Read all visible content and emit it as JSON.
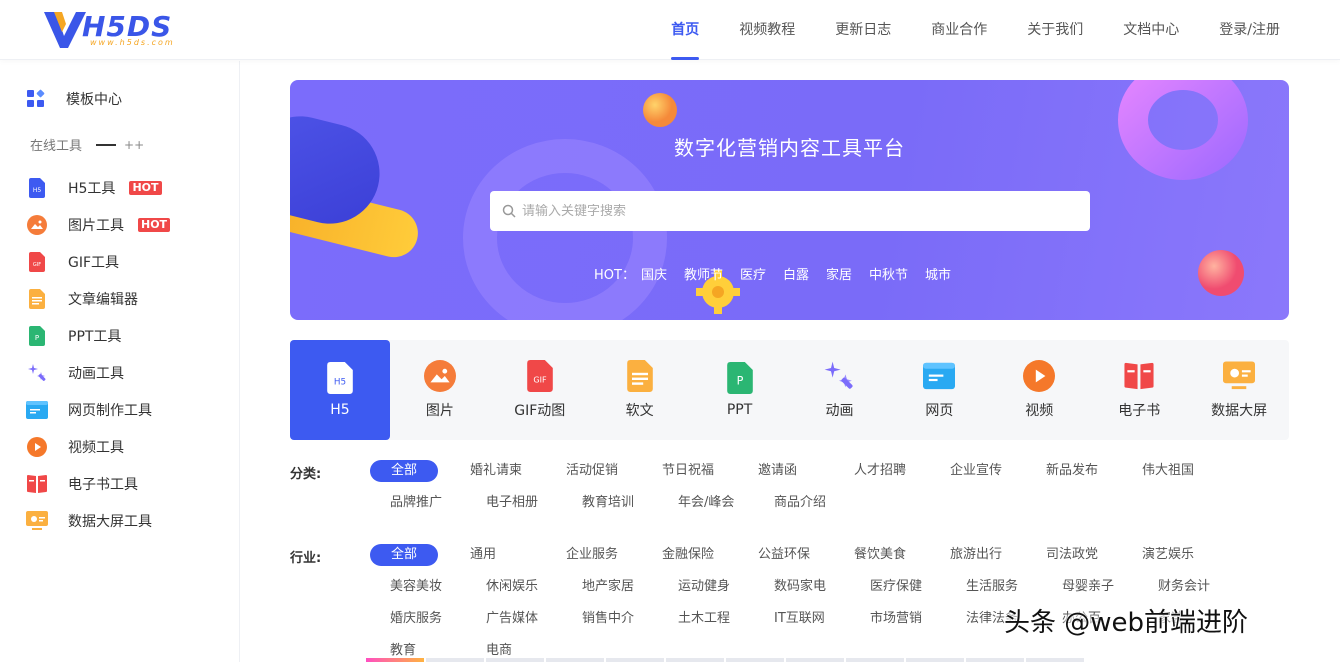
{
  "logo": {
    "word": "H5DS",
    "sub": "www.h5ds.com"
  },
  "nav": [
    {
      "label": "首页",
      "active": true
    },
    {
      "label": "视频教程"
    },
    {
      "label": "更新日志"
    },
    {
      "label": "商业合作"
    },
    {
      "label": "关于我们"
    },
    {
      "label": "文档中心"
    },
    {
      "label": "登录/注册"
    }
  ],
  "sidebar": {
    "head": "模板中心",
    "online_label": "在线工具",
    "online_expand": "++",
    "items": [
      {
        "label": "H5工具",
        "badge": "HOT",
        "icon": "h5-doc-icon"
      },
      {
        "label": "图片工具",
        "badge": "HOT",
        "icon": "image-icon"
      },
      {
        "label": "GIF工具",
        "icon": "gif-icon"
      },
      {
        "label": "文章编辑器",
        "icon": "article-icon"
      },
      {
        "label": "PPT工具",
        "icon": "ppt-icon"
      },
      {
        "label": "动画工具",
        "icon": "sparkle-icon"
      },
      {
        "label": "网页制作工具",
        "icon": "webpage-icon"
      },
      {
        "label": "视频工具",
        "icon": "video-icon"
      },
      {
        "label": "电子书工具",
        "icon": "ebook-icon"
      },
      {
        "label": "数据大屏工具",
        "icon": "dashboard-icon"
      }
    ]
  },
  "banner": {
    "title": "数字化营销内容工具平台",
    "search_placeholder": "请输入关键字搜索",
    "hot_label": "HOT：",
    "hot_keywords": [
      "国庆",
      "教师节",
      "医疗",
      "白露",
      "家居",
      "中秋节",
      "城市"
    ]
  },
  "tiles": [
    {
      "label": "H5",
      "active": true
    },
    {
      "label": "图片"
    },
    {
      "label": "GIF动图"
    },
    {
      "label": "软文"
    },
    {
      "label": "PPT"
    },
    {
      "label": "动画"
    },
    {
      "label": "网页"
    },
    {
      "label": "视频"
    },
    {
      "label": "电子书"
    },
    {
      "label": "数据大屏"
    }
  ],
  "filters": {
    "category": {
      "label": "分类:",
      "options": [
        "全部",
        "婚礼请柬",
        "活动促销",
        "节日祝福",
        "邀请函",
        "人才招聘",
        "企业宣传",
        "新品发布",
        "伟大祖国",
        "品牌推广",
        "电子相册",
        "教育培训",
        "年会/峰会",
        "商品介绍"
      ]
    },
    "industry": {
      "label": "行业:",
      "options": [
        "全部",
        "通用",
        "企业服务",
        "金融保险",
        "公益环保",
        "餐饮美食",
        "旅游出行",
        "司法政党",
        "演艺娱乐",
        "美容美妆",
        "休闲娱乐",
        "地产家居",
        "运动健身",
        "数码家电",
        "医疗保健",
        "生活服务",
        "母婴亲子",
        "财务会计",
        "婚庆服务",
        "广告媒体",
        "销售中介",
        "土木工程",
        "IT互联网",
        "市场营销",
        "法律法务",
        "办公百",
        "家装",
        "教育",
        "电商"
      ]
    }
  },
  "watermark": "头条 @web前端进阶",
  "colors": {
    "accent": "#3d5af1",
    "banner": "#7b6cfb",
    "hot_badge": "#f04848"
  }
}
